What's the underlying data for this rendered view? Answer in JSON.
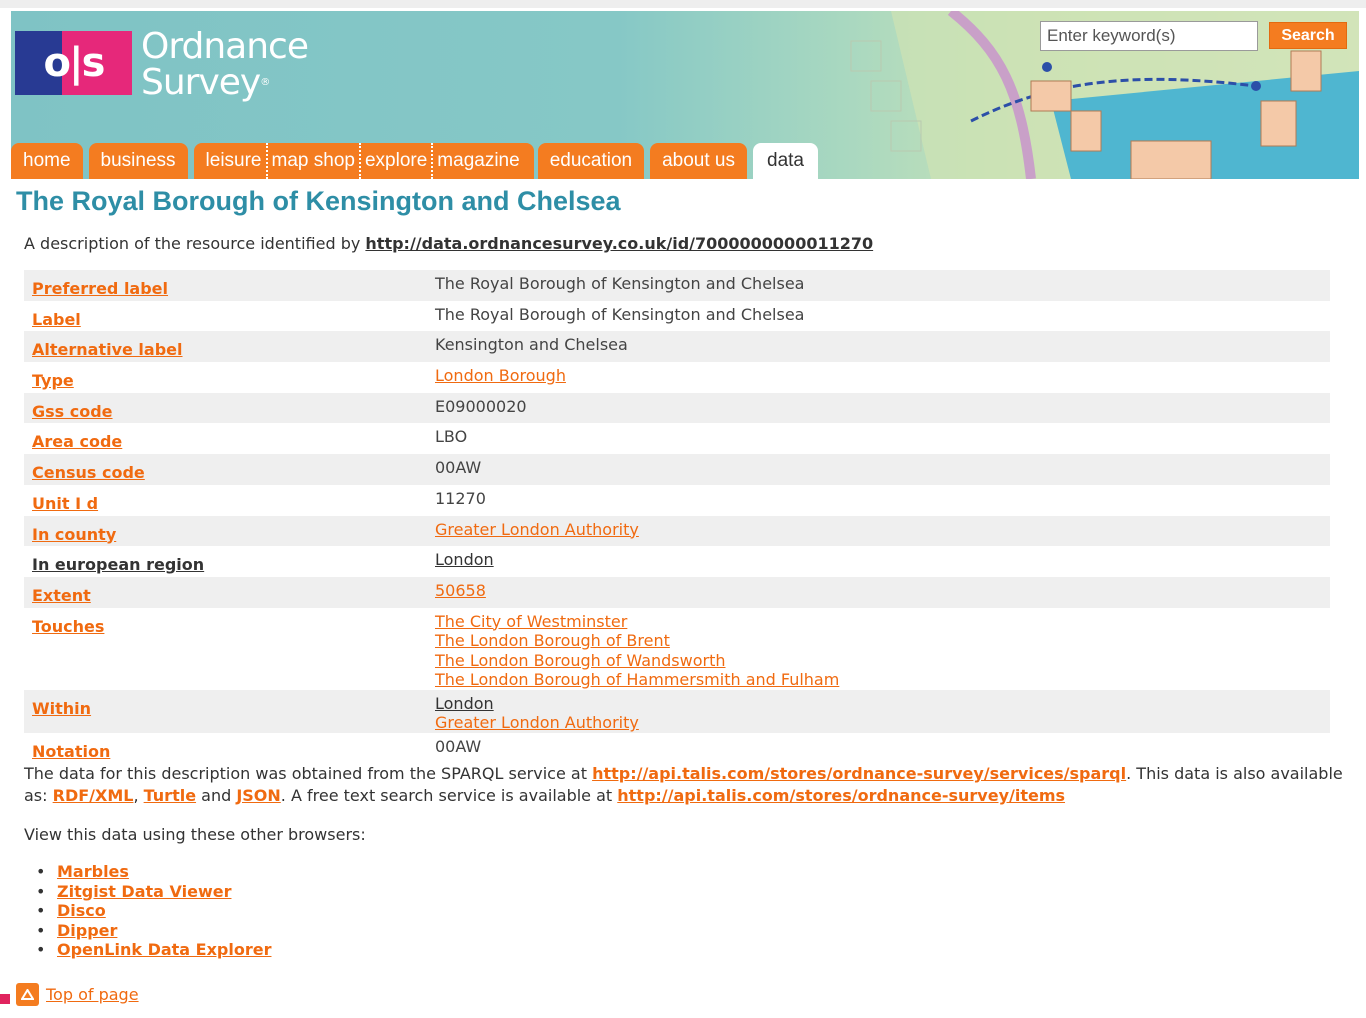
{
  "header": {
    "brand_line1": "Ordnance",
    "brand_line2": "Survey",
    "brand_mark": "®",
    "logo_text": "o|s",
    "search_placeholder": "Enter keyword(s)",
    "search_button": "Search"
  },
  "nav": {
    "tabs": [
      {
        "label": "home"
      },
      {
        "label": "business"
      },
      {
        "label": "leisure"
      },
      {
        "label": "map shop"
      },
      {
        "label": "explore"
      },
      {
        "label": "magazine"
      },
      {
        "label": "education"
      },
      {
        "label": "about us"
      },
      {
        "label": "data",
        "active": true
      }
    ]
  },
  "page": {
    "title": "The Royal Borough of Kensington and Chelsea",
    "description_prefix": "A description of the resource identified by ",
    "resource_uri": "http://data.ordnancesurvey.co.uk/id/7000000000011270"
  },
  "properties": [
    {
      "key": "Preferred label",
      "values": [
        "The Royal Borough of Kensington and Chelsea"
      ]
    },
    {
      "key": "Label",
      "values": [
        "The Royal Borough of Kensington and Chelsea"
      ]
    },
    {
      "key": "Alternative label",
      "values": [
        "Kensington and Chelsea"
      ]
    },
    {
      "key": "Type",
      "values": [
        "London Borough"
      ]
    },
    {
      "key": "Gss code",
      "values": [
        "E09000020"
      ]
    },
    {
      "key": "Area code",
      "values": [
        "LBO"
      ]
    },
    {
      "key": "Census code",
      "values": [
        "00AW"
      ]
    },
    {
      "key": "Unit I d",
      "values": [
        "11270"
      ]
    },
    {
      "key": "In county",
      "values": [
        "Greater London Authority"
      ]
    },
    {
      "key": "In european region",
      "values": [
        "London"
      ]
    },
    {
      "key": "Extent",
      "values": [
        "50658"
      ]
    },
    {
      "key": "Touches",
      "values": [
        "The City of Westminster",
        "The London Borough of Brent",
        "The London Borough of Wandsworth",
        "The London Borough of Hammersmith and Fulham"
      ]
    },
    {
      "key": "Within",
      "values": [
        "London",
        "Greater London Authority"
      ]
    },
    {
      "key": "Notation",
      "values": [
        "00AW"
      ]
    }
  ],
  "footer_note": {
    "part1": "The data for this description was obtained from the SPARQL service at ",
    "sparql_url": "http://api.talis.com/stores/ordnance-survey/services/sparql",
    "part2": ". This data is also available as: ",
    "rdf": "RDF/XML",
    "comma": ", ",
    "turtle": "Turtle",
    "and": " and ",
    "json": "JSON",
    "part3": ". A free text search service is available at ",
    "items_url": "http://api.talis.com/stores/ordnance-survey/items"
  },
  "browsers": {
    "intro": "View this data using these other browsers:",
    "bullet": "•",
    "items": [
      "Marbles",
      "Zitgist Data Viewer",
      "Disco",
      "Dipper",
      "OpenLink Data Explorer"
    ]
  },
  "top_of_page": "Top of page",
  "colors": {
    "accent": "#f47c20",
    "title": "#2e8ea6",
    "logo_blue": "#283a93",
    "logo_pink": "#e6287a"
  }
}
